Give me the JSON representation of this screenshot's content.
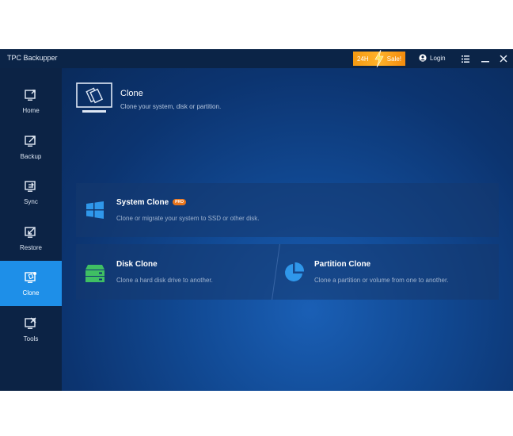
{
  "app": {
    "title": "TPC Backupper"
  },
  "titlebar": {
    "sale_left": "24H",
    "sale_right": "Sale!",
    "login_label": "Login"
  },
  "sidebar": {
    "items": [
      {
        "label": "Home"
      },
      {
        "label": "Backup"
      },
      {
        "label": "Sync"
      },
      {
        "label": "Restore"
      },
      {
        "label": "Clone",
        "active": true
      },
      {
        "label": "Tools"
      }
    ]
  },
  "main": {
    "title": "Clone",
    "description": "Clone your system, disk or partition.",
    "cards": {
      "system": {
        "title": "System Clone",
        "badge": "PRO",
        "description": "Clone or migrate your system to SSD or other disk."
      },
      "disk": {
        "title": "Disk Clone",
        "description": "Clone a hard disk drive to another."
      },
      "partition": {
        "title": "Partition Clone",
        "description": "Clone a partition or volume from one to another."
      }
    }
  },
  "colors": {
    "accent": "#1e8fe8",
    "sale": "#f59a12",
    "windows_icon": "#2f97ea",
    "disk_icon": "#3fbf63",
    "badge": "#e8741b"
  }
}
